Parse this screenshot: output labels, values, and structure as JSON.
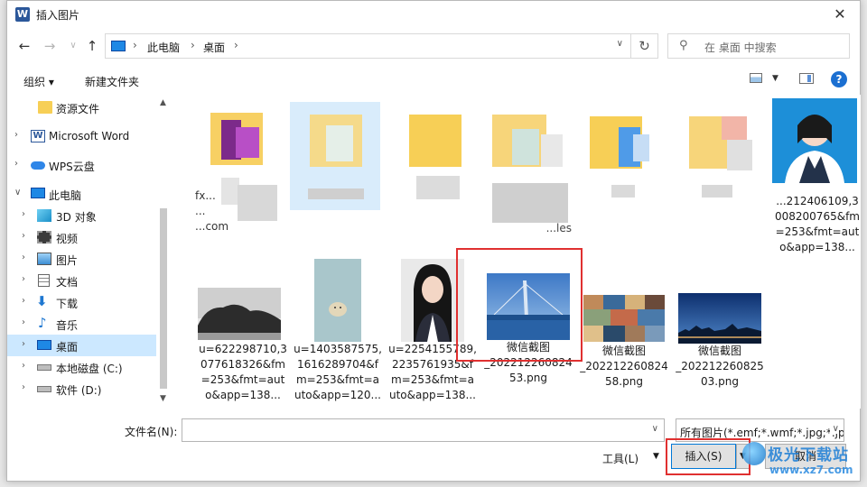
{
  "window": {
    "title": "插入图片",
    "app_icon_letter": "W"
  },
  "nav": {
    "crumbs": [
      "此电脑",
      "桌面"
    ],
    "search_placeholder": "在 桌面 中搜索"
  },
  "toolbar": {
    "organize": "组织 ▾",
    "new_folder": "新建文件夹"
  },
  "sidebar": {
    "items": [
      {
        "label": "资源文件",
        "icon": "folder-icon",
        "expander": false
      },
      {
        "label": "Microsoft Word",
        "icon": "word-icon",
        "expander": true
      },
      {
        "label": "WPS云盘",
        "icon": "cloud-icon",
        "expander": true
      },
      {
        "label": "此电脑",
        "icon": "pc-icon",
        "expander": true,
        "expanded": true
      },
      {
        "label": "3D 对象",
        "icon": "3d-icon",
        "expander": true
      },
      {
        "label": "视频",
        "icon": "video-icon",
        "expander": true
      },
      {
        "label": "图片",
        "icon": "pictures-icon",
        "expander": true
      },
      {
        "label": "文档",
        "icon": "documents-icon",
        "expander": true
      },
      {
        "label": "下载",
        "icon": "download-icon",
        "expander": true
      },
      {
        "label": "音乐",
        "icon": "music-icon",
        "expander": true
      },
      {
        "label": "桌面",
        "icon": "desktop-icon",
        "expander": true,
        "selected": true
      },
      {
        "label": "本地磁盘 (C:)",
        "icon": "drive-icon",
        "expander": true
      },
      {
        "label": "软件 (D:)",
        "icon": "drive-icon",
        "expander": true
      }
    ]
  },
  "files": [
    {
      "name": "fx...\n...\n...com",
      "kind": "folder-blurred"
    },
    {
      "name": "",
      "kind": "folder-blurred-selected"
    },
    {
      "name": "",
      "kind": "folder-blurred"
    },
    {
      "name": "...les",
      "kind": "folder-blurred"
    },
    {
      "name": "",
      "kind": "folder-blurred"
    },
    {
      "name": "",
      "kind": "folder-blurred"
    },
    {
      "name": "...212406109,3\n008200765&fm\n=253&fmt=aut\no&app=138...",
      "kind": "portrait-girl"
    },
    {
      "name": "u=622298710,3\n077618326&fm\n=253&fmt=aut\no&app=138...",
      "kind": "bw-landscape"
    },
    {
      "name": "u=1403587575,\n1616289704&f\nm=253&fmt=a\nuto&app=120...",
      "kind": "cartoon"
    },
    {
      "name": "u=2254155789,\n2235761935&f\nm=253&fmt=a\nuto&app=138...",
      "kind": "portrait-woman"
    },
    {
      "name": "微信截图\n_202212260824\n53.png",
      "kind": "bridge",
      "highlighted": true
    },
    {
      "name": "微信截图\n_202212260824\n58.png",
      "kind": "collage"
    },
    {
      "name": "微信截图\n_202212260825\n03.png",
      "kind": "cityscape"
    }
  ],
  "bottom": {
    "filename_label": "文件名(N):",
    "filename_value": "",
    "filter": "所有图片(*.emf;*.wmf;*.jpg;*.jp",
    "tools": "工具(L)",
    "insert": "插入(S)",
    "cancel": "取消"
  },
  "watermark": {
    "line1": "极光下载站",
    "line2": "www.xz7.com"
  },
  "colors": {
    "selection": "#cce8ff",
    "highlight_box": "#e03030",
    "accent": "#0078d7"
  }
}
